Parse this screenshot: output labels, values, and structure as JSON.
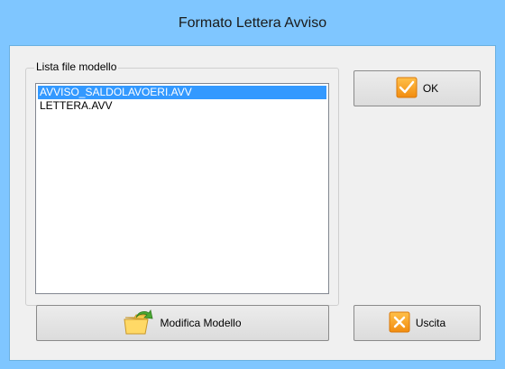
{
  "window": {
    "title": "Formato Lettera Avviso"
  },
  "group": {
    "legend": "Lista file modello",
    "items": [
      {
        "label": "AVVISO_SALDOLAVOERI.AVV",
        "selected": true
      },
      {
        "label": "LETTERA.AVV",
        "selected": false
      }
    ]
  },
  "buttons": {
    "ok_label": "OK",
    "modifica_label": "Modifica Modello",
    "uscita_label": "Uscita"
  },
  "icons": {
    "ok": "checkmark-icon",
    "modifica": "folder-arrow-icon",
    "uscita": "close-x-icon"
  },
  "colors": {
    "titlebar": "#7fc6ff",
    "selection": "#3399ff",
    "icon_orange": "#f7a21b"
  }
}
